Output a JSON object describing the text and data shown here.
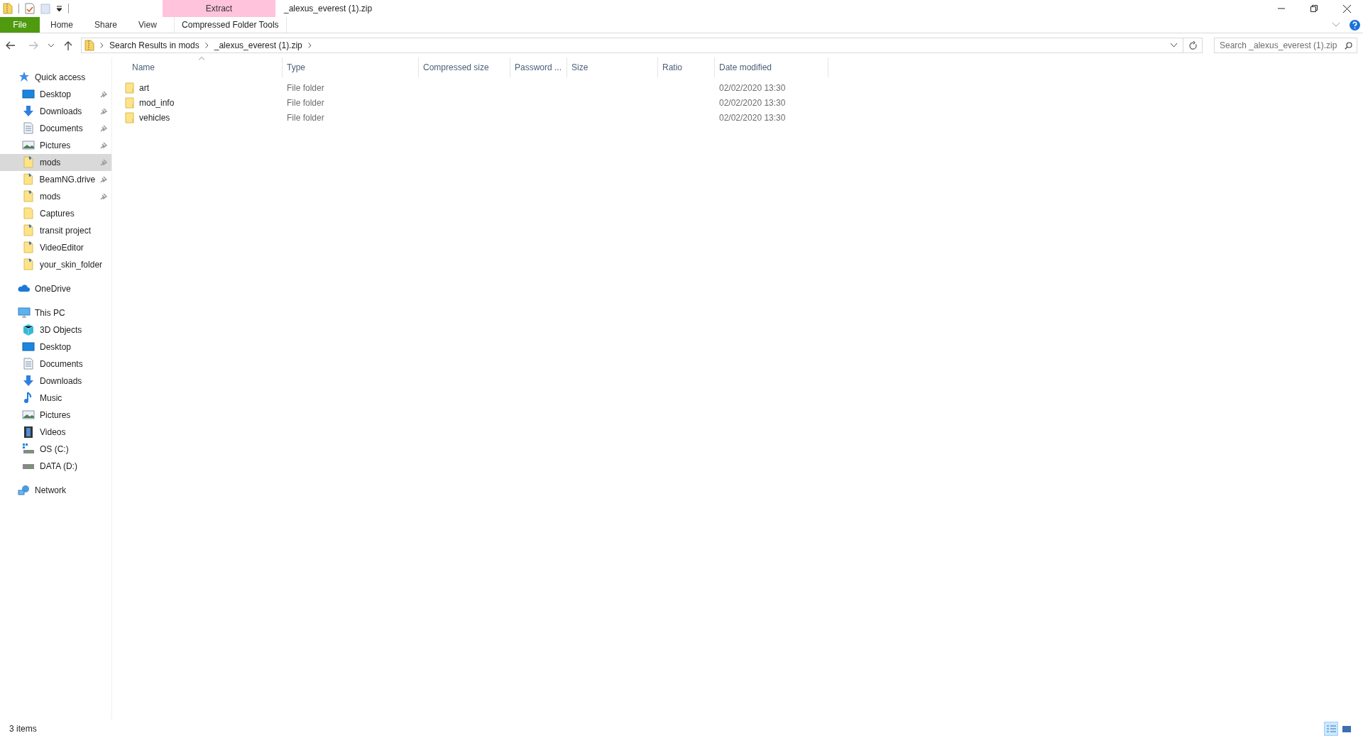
{
  "window": {
    "title": "_alexus_everest (1).zip",
    "context_tab_group": "Extract"
  },
  "ribbon_tabs": [
    {
      "label": "File",
      "kind": "file",
      "selected": false
    },
    {
      "label": "Home",
      "kind": "tab",
      "selected": false
    },
    {
      "label": "Share",
      "kind": "tab",
      "selected": false
    },
    {
      "label": "View",
      "kind": "tab",
      "selected": false
    },
    {
      "label": "Compressed Folder Tools",
      "kind": "context",
      "selected": false
    }
  ],
  "address_bar": {
    "crumbs": [
      "Search Results in mods",
      "_alexus_everest (1).zip"
    ]
  },
  "search": {
    "placeholder": "Search _alexus_everest (1).zip"
  },
  "sidebar": {
    "sections": [
      {
        "label": "Quick access",
        "kind": "star",
        "children": [
          {
            "label": "Desktop",
            "kind": "desktop",
            "pinned": true,
            "selected": false
          },
          {
            "label": "Downloads",
            "kind": "downloads",
            "pinned": true,
            "selected": false
          },
          {
            "label": "Documents",
            "kind": "documents",
            "pinned": true,
            "selected": false
          },
          {
            "label": "Pictures",
            "kind": "pictures",
            "pinned": true,
            "selected": false
          },
          {
            "label": "mods",
            "kind": "shortcut",
            "pinned": true,
            "selected": true
          },
          {
            "label": "BeamNG.drive",
            "kind": "shortcut",
            "pinned": true,
            "selected": false
          },
          {
            "label": "mods",
            "kind": "shortcut",
            "pinned": true,
            "selected": false
          },
          {
            "label": "Captures",
            "kind": "folder",
            "pinned": false,
            "selected": false
          },
          {
            "label": "transit project",
            "kind": "shortcut",
            "pinned": false,
            "selected": false
          },
          {
            "label": "VideoEditor",
            "kind": "shortcut",
            "pinned": false,
            "selected": false
          },
          {
            "label": "your_skin_folder",
            "kind": "shortcut",
            "pinned": false,
            "selected": false
          }
        ]
      },
      {
        "label": "OneDrive",
        "kind": "cloud"
      },
      {
        "label": "This PC",
        "kind": "pc",
        "children": [
          {
            "label": "3D Objects",
            "kind": "cube",
            "pinned": false,
            "selected": false
          },
          {
            "label": "Desktop",
            "kind": "desktop",
            "pinned": false,
            "selected": false
          },
          {
            "label": "Documents",
            "kind": "documents",
            "pinned": false,
            "selected": false
          },
          {
            "label": "Downloads",
            "kind": "downloads",
            "pinned": false,
            "selected": false
          },
          {
            "label": "Music",
            "kind": "music",
            "pinned": false,
            "selected": false
          },
          {
            "label": "Pictures",
            "kind": "pictures",
            "pinned": false,
            "selected": false
          },
          {
            "label": "Videos",
            "kind": "videos",
            "pinned": false,
            "selected": false
          },
          {
            "label": "OS (C:)",
            "kind": "osdrive",
            "pinned": false,
            "selected": false
          },
          {
            "label": "DATA (D:)",
            "kind": "drive",
            "pinned": false,
            "selected": false
          }
        ]
      },
      {
        "label": "Network",
        "kind": "network"
      }
    ]
  },
  "table": {
    "columns": [
      "Name",
      "Type",
      "Compressed size",
      "Password ...",
      "Size",
      "Ratio",
      "Date modified"
    ],
    "rows": [
      {
        "name": "art",
        "type": "File folder",
        "date_modified": "02/02/2020 13:30"
      },
      {
        "name": "mod_info",
        "type": "File folder",
        "date_modified": "02/02/2020 13:30"
      },
      {
        "name": "vehicles",
        "type": "File folder",
        "date_modified": "02/02/2020 13:30"
      }
    ]
  },
  "status_bar": {
    "item_count": "3 items",
    "view_buttons": [
      {
        "kind": "details",
        "selected": true
      },
      {
        "kind": "large_icons",
        "selected": false
      }
    ]
  }
}
